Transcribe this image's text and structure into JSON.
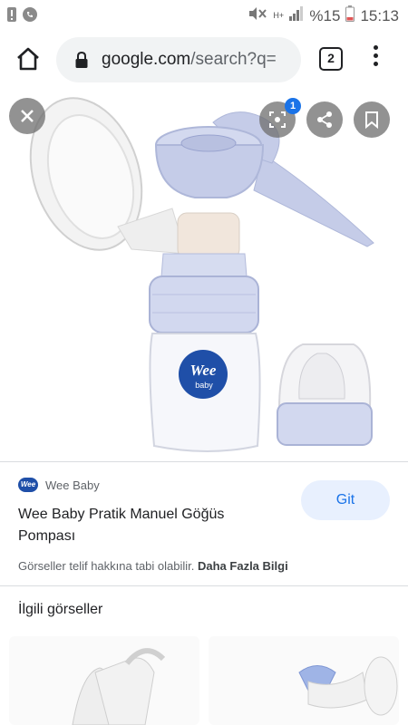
{
  "status_bar": {
    "battery_percent": "%15",
    "time": "15:13",
    "network": "H+"
  },
  "browser": {
    "url_domain": "google.com",
    "url_path": "/search?q=",
    "tab_count": "2"
  },
  "image": {
    "product_logo_top": "Wee",
    "product_logo_bottom": "baby",
    "lens_badge": "1"
  },
  "result": {
    "source_logo": "Wee",
    "source_name": "Wee Baby",
    "title": "Wee Baby Pratik Manuel Göğüs Pompası",
    "visit_label": "Git",
    "copyright_text": "Görseller telif hakkına tabi olabilir.",
    "more_info_label": "Daha Fazla Bilgi"
  },
  "related": {
    "heading": "İlgili görseller"
  },
  "colors": {
    "accent": "#1a73e8",
    "pump_blue": "#c5cce8",
    "brand_logo": "#1f4fa8"
  }
}
